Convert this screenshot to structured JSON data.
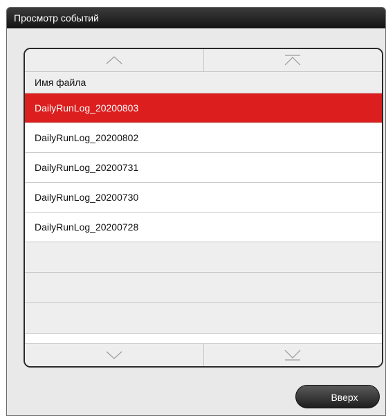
{
  "dialog": {
    "title": "Просмотр событий"
  },
  "table": {
    "column_header": "Имя файла",
    "selected_index": 0,
    "files": [
      "DailyRunLog_20200803",
      "DailyRunLog_20200802",
      "DailyRunLog_20200731",
      "DailyRunLog_20200730",
      "DailyRunLog_20200728"
    ]
  },
  "scroll": {
    "icons": [
      "chevron-up-icon",
      "scroll-to-top-icon",
      "chevron-down-icon",
      "scroll-to-bottom-icon"
    ]
  },
  "actions": {
    "up_label": "Вверх"
  },
  "colors": {
    "selected_row": "#dc1e1e",
    "titlebar": "#1e1e1e"
  }
}
